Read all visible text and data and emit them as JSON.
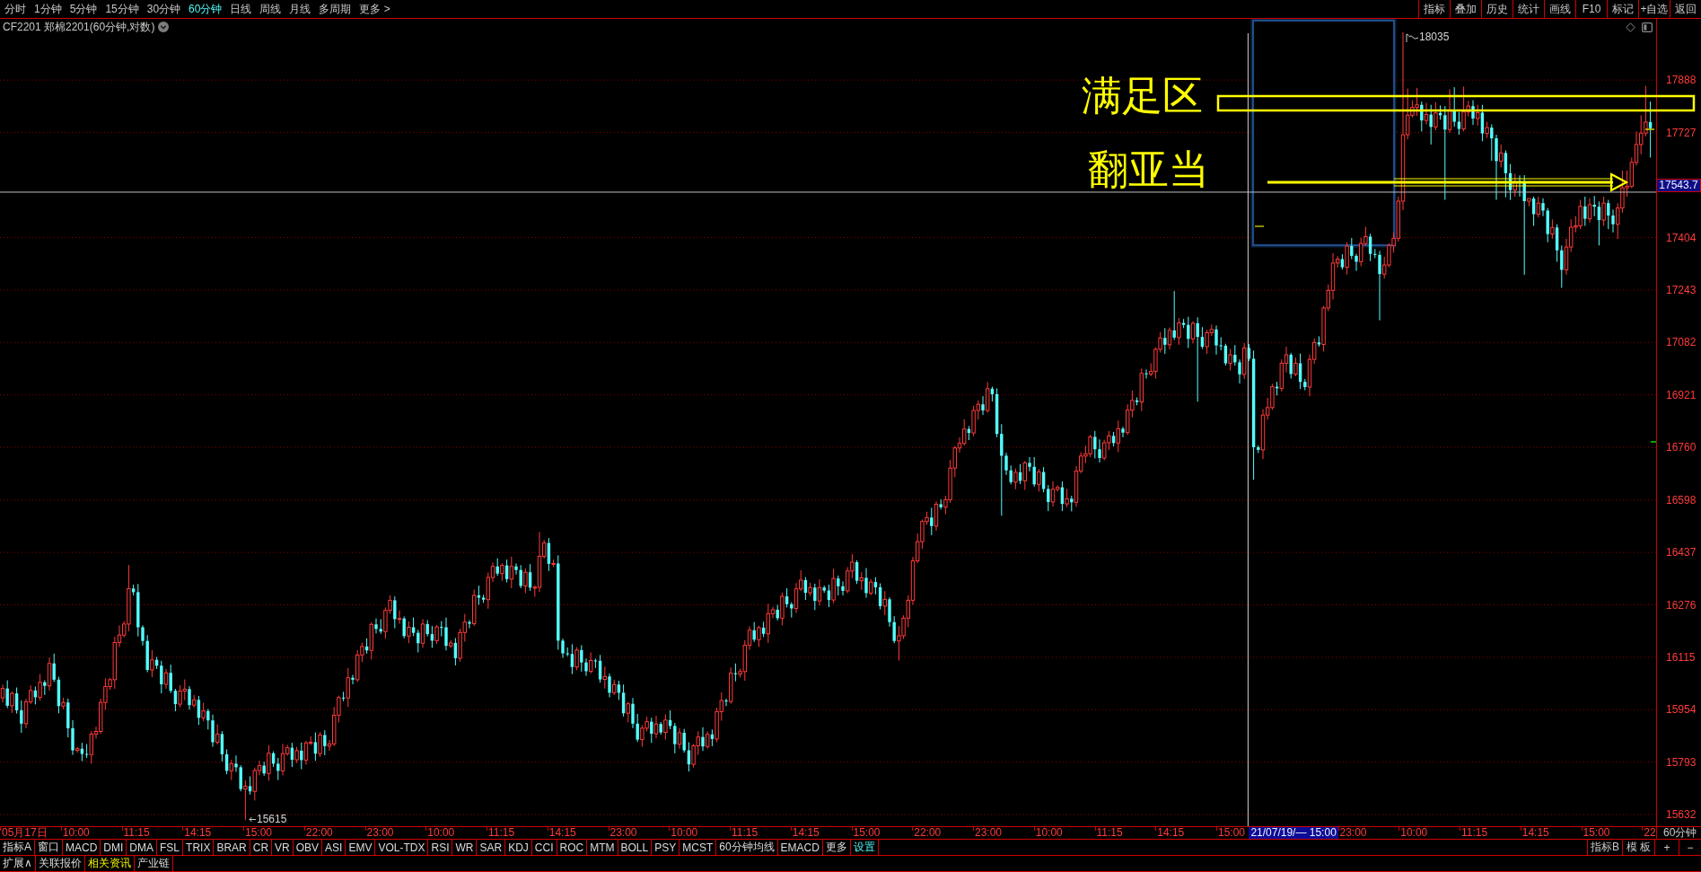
{
  "toolbar": {
    "periods": [
      {
        "label": "分时",
        "selected": false
      },
      {
        "label": "1分钟",
        "selected": false
      },
      {
        "label": "5分钟",
        "selected": false
      },
      {
        "label": "15分钟",
        "selected": false
      },
      {
        "label": "30分钟",
        "selected": false
      },
      {
        "label": "60分钟",
        "selected": true
      },
      {
        "label": "日线",
        "selected": false
      },
      {
        "label": "周线",
        "selected": false
      },
      {
        "label": "月线",
        "selected": false
      },
      {
        "label": "多周期",
        "selected": false
      },
      {
        "label": "更多 >",
        "selected": false
      }
    ],
    "actions": [
      "指标",
      "叠加",
      "历史",
      "统计",
      "画线",
      "F10",
      "标记",
      "+自选",
      "返回"
    ]
  },
  "chart": {
    "title": "CF2201 郑棉2201(60分钟,对数)",
    "high_marker": "18035",
    "low_marker": "15615",
    "annotations": [
      "满足区",
      "翻亚当"
    ],
    "current_price": "17543.7",
    "period_label": "60分钟",
    "time_axis": [
      {
        "kind": "tick",
        "text": "05月17日"
      },
      {
        "kind": "tick",
        "text": "10:00"
      },
      {
        "kind": "tick",
        "text": "11:15"
      },
      {
        "kind": "tick",
        "text": "14:15"
      },
      {
        "kind": "tick",
        "text": "15:00"
      },
      {
        "kind": "tick",
        "text": "22:00"
      },
      {
        "kind": "tick",
        "text": "23:00"
      },
      {
        "kind": "tick",
        "text": "10:00"
      },
      {
        "kind": "tick",
        "text": "11:15"
      },
      {
        "kind": "tick",
        "text": "14:15"
      },
      {
        "kind": "tick",
        "text": "23:00"
      },
      {
        "kind": "tick",
        "text": "10:00"
      },
      {
        "kind": "tick",
        "text": "11:15"
      },
      {
        "kind": "tick",
        "text": "14:15"
      },
      {
        "kind": "tick",
        "text": "15:00"
      },
      {
        "kind": "tick",
        "text": "22:00"
      },
      {
        "kind": "tick",
        "text": "23:00"
      },
      {
        "kind": "tick",
        "text": "10:00"
      },
      {
        "kind": "tick",
        "text": "11:15"
      },
      {
        "kind": "tick",
        "text": "14:15"
      },
      {
        "kind": "tick",
        "text": "15:00"
      },
      {
        "kind": "cursor",
        "text": "21/07/19/— 15:00"
      },
      {
        "kind": "tick",
        "text": "23:00"
      },
      {
        "kind": "tick",
        "text": "10:00"
      },
      {
        "kind": "tick",
        "text": "11:15"
      },
      {
        "kind": "tick",
        "text": "14:15"
      },
      {
        "kind": "tick",
        "text": "15:00"
      },
      {
        "kind": "tick",
        "text": "22"
      }
    ],
    "chart_data": {
      "type": "candlestick",
      "grid": true,
      "ylim": [
        15596,
        18076
      ],
      "yticks": [
        {
          "value": 17888,
          "label": "17888"
        },
        {
          "value": 17727,
          "label": "17727"
        },
        {
          "value": 17404,
          "label": "17404"
        },
        {
          "value": 17243,
          "label": "17243"
        },
        {
          "value": 17082,
          "label": "17082"
        },
        {
          "value": 16921,
          "label": "16921"
        },
        {
          "value": 16760,
          "label": "16760"
        },
        {
          "value": 16598,
          "label": "16598"
        },
        {
          "value": 16437,
          "label": "16437"
        },
        {
          "value": 16276,
          "label": "16276"
        },
        {
          "value": 16115,
          "label": "16115"
        },
        {
          "value": 15954,
          "label": "15954"
        },
        {
          "value": 15793,
          "label": "15793"
        },
        {
          "value": 15632,
          "label": "15632"
        }
      ],
      "ohlc": [
        [
          15990,
          16031,
          15976,
          16019
        ],
        [
          16019,
          16044,
          15959,
          15966
        ],
        [
          15966,
          16010,
          15944,
          16004
        ],
        [
          16004,
          16022,
          15942,
          15952
        ],
        [
          15952,
          15982,
          15883,
          15911
        ],
        [
          15911,
          15987,
          15897,
          15978
        ],
        [
          15978,
          16028,
          15971,
          16013
        ],
        [
          16013,
          16025,
          15970,
          15992
        ],
        [
          15992,
          16063,
          15982,
          16038
        ],
        [
          16038,
          16044,
          15999,
          16027
        ],
        [
          16027,
          16114,
          16013,
          16096
        ],
        [
          16096,
          16126,
          16039,
          16046
        ],
        [
          16046,
          16055,
          15943,
          15965
        ],
        [
          15965,
          15991,
          15955,
          15976
        ],
        [
          15976,
          15988,
          15869,
          15897
        ],
        [
          15897,
          15922,
          15815,
          15829
        ],
        [
          15829,
          15840,
          15822,
          15834
        ],
        [
          15834,
          15852,
          15796,
          15818
        ],
        [
          15818,
          15848,
          15806,
          15816
        ],
        [
          15816,
          15888,
          15788,
          15879
        ],
        [
          15879,
          15902,
          15865,
          15887
        ],
        [
          15887,
          15988,
          15880,
          15976
        ],
        [
          15976,
          16050,
          15954,
          16025
        ],
        [
          16025,
          16052,
          16015,
          16046
        ],
        [
          16046,
          16178,
          16018,
          16160
        ],
        [
          16160,
          16213,
          16146,
          16183
        ],
        [
          16183,
          16226,
          16176,
          16217
        ],
        [
          16217,
          16398,
          16195,
          16326
        ],
        [
          16326,
          16338,
          16305,
          16315
        ],
        [
          16315,
          16340,
          16179,
          16207
        ],
        [
          16207,
          16213,
          16151,
          16165
        ],
        [
          16165,
          16183,
          16069,
          16076
        ],
        [
          16076,
          16137,
          16054,
          16107
        ],
        [
          16107,
          16116,
          16079,
          16089
        ],
        [
          16089,
          16104,
          16004,
          16032
        ],
        [
          16032,
          16079,
          16018,
          16067
        ],
        [
          16067,
          16092,
          16005,
          16012
        ],
        [
          16012,
          16018,
          15949,
          15971
        ],
        [
          15971,
          16029,
          15961,
          16011
        ],
        [
          16011,
          16047,
          15983,
          16017
        ],
        [
          16017,
          16026,
          15954,
          15968
        ],
        [
          15968,
          15999,
          15961,
          15984
        ],
        [
          15984,
          15996,
          15907,
          15929
        ],
        [
          15929,
          15975,
          15919,
          15950
        ],
        [
          15950,
          15956,
          15893,
          15921
        ],
        [
          15921,
          15939,
          15840,
          15854
        ],
        [
          15854,
          15909,
          15847,
          15879
        ],
        [
          15879,
          15888,
          15795,
          15817
        ],
        [
          15817,
          15832,
          15756,
          15766
        ],
        [
          15766,
          15800,
          15738,
          15788
        ],
        [
          15788,
          15813,
          15763,
          15777
        ],
        [
          15777,
          15783,
          15703,
          15710
        ],
        [
          15710,
          15737,
          15615,
          15719
        ],
        [
          15719,
          15749,
          15693,
          15703
        ],
        [
          15703,
          15776,
          15675,
          15767
        ],
        [
          15767,
          15797,
          15753,
          15782
        ],
        [
          15782,
          15794,
          15751,
          15758
        ],
        [
          15758,
          15845,
          15736,
          15820
        ],
        [
          15820,
          15826,
          15778,
          15788
        ],
        [
          15788,
          15806,
          15738,
          15766
        ],
        [
          15766,
          15849,
          15752,
          15819
        ],
        [
          15819,
          15846,
          15812,
          15837
        ],
        [
          15837,
          15852,
          15778,
          15800
        ],
        [
          15800,
          15840,
          15790,
          15828
        ],
        [
          15828,
          15853,
          15771,
          15799
        ],
        [
          15799,
          15858,
          15785,
          15852
        ],
        [
          15852,
          15872,
          15845,
          15854
        ],
        [
          15854,
          15884,
          15797,
          15819
        ],
        [
          15819,
          15885,
          15809,
          15876
        ],
        [
          15876,
          15891,
          15814,
          15842
        ],
        [
          15842,
          15861,
          15828,
          15849
        ],
        [
          15849,
          15962,
          15842,
          15937
        ],
        [
          15937,
          15997,
          15915,
          15991
        ],
        [
          15991,
          16009,
          15980,
          15990
        ],
        [
          15990,
          16082,
          15962,
          16052
        ],
        [
          16052,
          16061,
          16032,
          16046
        ],
        [
          16046,
          16137,
          16039,
          16122
        ],
        [
          16122,
          16160,
          16100,
          16148
        ],
        [
          16148,
          16173,
          16126,
          16136
        ],
        [
          16136,
          16222,
          16108,
          16216
        ],
        [
          16216,
          16234,
          16188,
          16202
        ],
        [
          16202,
          16232,
          16187,
          16194
        ],
        [
          16194,
          16268,
          16172,
          16259
        ],
        [
          16259,
          16305,
          16249,
          16290
        ],
        [
          16290,
          16302,
          16204,
          16232
        ],
        [
          16232,
          16259,
          16218,
          16234
        ],
        [
          16234,
          16240,
          16173,
          16180
        ],
        [
          16180,
          16225,
          16158,
          16207
        ],
        [
          16207,
          16237,
          16180,
          16190
        ],
        [
          16190,
          16199,
          16130,
          16158
        ],
        [
          16158,
          16232,
          16144,
          16217
        ],
        [
          16217,
          16229,
          16179,
          16186
        ],
        [
          16186,
          16211,
          16144,
          16166
        ],
        [
          16166,
          16214,
          16156,
          16208
        ],
        [
          16208,
          16226,
          16179,
          16207
        ],
        [
          16207,
          16237,
          16136,
          16150
        ],
        [
          16150,
          16168,
          16143,
          16159
        ],
        [
          16159,
          16174,
          16090,
          16112
        ],
        [
          16112,
          16203,
          16102,
          16191
        ],
        [
          16191,
          16248,
          16163,
          16223
        ],
        [
          16223,
          16229,
          16204,
          16218
        ],
        [
          16218,
          16323,
          16211,
          16305
        ],
        [
          16305,
          16335,
          16276,
          16298
        ],
        [
          16298,
          16307,
          16282,
          16292
        ],
        [
          16292,
          16375,
          16264,
          16360
        ],
        [
          16360,
          16406,
          16346,
          16394
        ],
        [
          16394,
          16419,
          16365,
          16372
        ],
        [
          16372,
          16403,
          16350,
          16397
        ],
        [
          16397,
          16415,
          16345,
          16355
        ],
        [
          16355,
          16424,
          16327,
          16394
        ],
        [
          16394,
          16403,
          16369,
          16383
        ],
        [
          16383,
          16398,
          16327,
          16334
        ],
        [
          16334,
          16388,
          16312,
          16376
        ],
        [
          16376,
          16401,
          16319,
          16329
        ],
        [
          16329,
          16336,
          16301,
          16330
        ],
        [
          16330,
          16500,
          16316,
          16425
        ],
        [
          16425,
          16475,
          16418,
          16466
        ],
        [
          16466,
          16481,
          16380,
          16402
        ],
        [
          16402,
          16415,
          16392,
          16403
        ],
        [
          16403,
          16428,
          16138,
          16166
        ],
        [
          16166,
          16172,
          16113,
          16127
        ],
        [
          16127,
          16145,
          16118,
          16125
        ],
        [
          16125,
          16155,
          16063,
          16085
        ],
        [
          16085,
          16146,
          16075,
          16137
        ],
        [
          16137,
          16152,
          16071,
          16099
        ],
        [
          16099,
          16111,
          16058,
          16072
        ],
        [
          16072,
          16130,
          16065,
          16105
        ],
        [
          16105,
          16111,
          16082,
          16104
        ],
        [
          16104,
          16122,
          16037,
          16047
        ],
        [
          16047,
          16086,
          16019,
          16056
        ],
        [
          16056,
          16065,
          15992,
          16006
        ],
        [
          16006,
          16046,
          15999,
          16031
        ],
        [
          16031,
          16043,
          15984,
          16006
        ],
        [
          16006,
          16031,
          15933,
          15943
        ],
        [
          15943,
          15978,
          15915,
          15972
        ],
        [
          15972,
          15990,
          15897,
          15911
        ],
        [
          15911,
          15941,
          15855,
          15862
        ],
        [
          15862,
          15906,
          15840,
          15897
        ],
        [
          15897,
          15932,
          15887,
          15917
        ],
        [
          15917,
          15929,
          15852,
          15880
        ],
        [
          15880,
          15935,
          15866,
          15910
        ],
        [
          15910,
          15916,
          15877,
          15884
        ],
        [
          15884,
          15940,
          15862,
          15922
        ],
        [
          15922,
          15952,
          15894,
          15904
        ],
        [
          15904,
          15913,
          15820,
          15848
        ],
        [
          15848,
          15898,
          15834,
          15883
        ],
        [
          15883,
          15895,
          15822,
          15829
        ],
        [
          15829,
          15854,
          15764,
          15786
        ],
        [
          15786,
          15849,
          15776,
          15843
        ],
        [
          15843,
          15888,
          15815,
          15870
        ],
        [
          15870,
          15900,
          15827,
          15841
        ],
        [
          15841,
          15887,
          15834,
          15878
        ],
        [
          15878,
          15893,
          15842,
          15864
        ],
        [
          15864,
          15960,
          15854,
          15948
        ],
        [
          15948,
          16007,
          15920,
          15982
        ],
        [
          15982,
          15988,
          15965,
          15979
        ],
        [
          15979,
          16084,
          15972,
          16066
        ],
        [
          16066,
          16096,
          16041,
          16063
        ],
        [
          16063,
          16080,
          16053,
          16071
        ],
        [
          16071,
          16167,
          16043,
          16152
        ],
        [
          16152,
          16210,
          16138,
          16198
        ],
        [
          16198,
          16223,
          16162,
          16169
        ],
        [
          16169,
          16212,
          16147,
          16206
        ],
        [
          16206,
          16224,
          16177,
          16187
        ],
        [
          16187,
          16279,
          16159,
          16249
        ],
        [
          16249,
          16270,
          16235,
          16261
        ],
        [
          16261,
          16276,
          16228,
          16235
        ],
        [
          16235,
          16314,
          16213,
          16302
        ],
        [
          16302,
          16327,
          16268,
          16278
        ],
        [
          16278,
          16284,
          16237,
          16265
        ],
        [
          16265,
          16343,
          16251,
          16325
        ],
        [
          16325,
          16382,
          16318,
          16352
        ],
        [
          16352,
          16361,
          16291,
          16313
        ],
        [
          16313,
          16344,
          16303,
          16329
        ],
        [
          16329,
          16341,
          16260,
          16288
        ],
        [
          16288,
          16354,
          16274,
          16329
        ],
        [
          16329,
          16335,
          16313,
          16320
        ],
        [
          16320,
          16338,
          16269,
          16291
        ],
        [
          16291,
          16387,
          16281,
          16357
        ],
        [
          16357,
          16366,
          16305,
          16333
        ],
        [
          16333,
          16348,
          16305,
          16319
        ],
        [
          16319,
          16392,
          16312,
          16380
        ],
        [
          16380,
          16432,
          16358,
          16407
        ],
        [
          16407,
          16413,
          16340,
          16350
        ],
        [
          16350,
          16377,
          16322,
          16359
        ],
        [
          16359,
          16389,
          16298,
          16312
        ],
        [
          16312,
          16355,
          16305,
          16346
        ],
        [
          16346,
          16361,
          16308,
          16330
        ],
        [
          16330,
          16342,
          16262,
          16272
        ],
        [
          16272,
          16318,
          16244,
          16293
        ],
        [
          16293,
          16299,
          16209,
          16223
        ],
        [
          16223,
          16241,
          16158,
          16165
        ],
        [
          16165,
          16211,
          16105,
          16181
        ],
        [
          16181,
          16244,
          16171,
          16235
        ],
        [
          16235,
          16305,
          16207,
          16290
        ],
        [
          16290,
          16423,
          16276,
          16411
        ],
        [
          16411,
          16495,
          16404,
          16470
        ],
        [
          16470,
          16538,
          16448,
          16532
        ],
        [
          16532,
          16562,
          16522,
          16544
        ],
        [
          16544,
          16574,
          16490,
          16518
        ],
        [
          16518,
          16594,
          16504,
          16585
        ],
        [
          16585,
          16600,
          16569,
          16576
        ],
        [
          16576,
          16611,
          16554,
          16599
        ],
        [
          16599,
          16721,
          16589,
          16696
        ],
        [
          16696,
          16764,
          16668,
          16758
        ],
        [
          16758,
          16790,
          16744,
          16772
        ],
        [
          16772,
          16846,
          16765,
          16816
        ],
        [
          16816,
          16825,
          16782,
          16804
        ],
        [
          16804,
          16888,
          16794,
          16873
        ],
        [
          16873,
          16904,
          16845,
          16892
        ],
        [
          16892,
          16917,
          16859,
          16873
        ],
        [
          16873,
          16960,
          16866,
          16940
        ],
        [
          16940,
          16946,
          16901,
          16923
        ],
        [
          16923,
          16941,
          16791,
          16801
        ],
        [
          16801,
          16831,
          16550,
          16734
        ],
        [
          16734,
          16743,
          16675,
          16689
        ],
        [
          16689,
          16704,
          16646,
          16653
        ],
        [
          16653,
          16695,
          16631,
          16683
        ],
        [
          16683,
          16708,
          16647,
          16657
        ],
        [
          16657,
          16718,
          16629,
          16712
        ],
        [
          16712,
          16730,
          16686,
          16700
        ],
        [
          16700,
          16730,
          16639,
          16646
        ],
        [
          16646,
          16693,
          16624,
          16684
        ],
        [
          16684,
          16699,
          16622,
          16632
        ],
        [
          16632,
          16644,
          16564,
          16592
        ],
        [
          16592,
          16656,
          16578,
          16631
        ],
        [
          16631,
          16643,
          16624,
          16637
        ],
        [
          16637,
          16655,
          16564,
          16586
        ],
        [
          16586,
          16632,
          16576,
          16602
        ],
        [
          16602,
          16611,
          16563,
          16591
        ],
        [
          16591,
          16702,
          16577,
          16687
        ],
        [
          16687,
          16745,
          16680,
          16733
        ],
        [
          16733,
          16765,
          16711,
          16740
        ],
        [
          16740,
          16798,
          16730,
          16792
        ],
        [
          16792,
          16810,
          16726,
          16754
        ],
        [
          16754,
          16784,
          16713,
          16727
        ],
        [
          16727,
          16783,
          16720,
          16774
        ],
        [
          16774,
          16810,
          16752,
          16795
        ],
        [
          16795,
          16807,
          16763,
          16773
        ],
        [
          16773,
          16842,
          16745,
          16817
        ],
        [
          16817,
          16823,
          16791,
          16805
        ],
        [
          16805,
          16892,
          16798,
          16874
        ],
        [
          16874,
          16934,
          16852,
          16904
        ],
        [
          16904,
          16913,
          16889,
          16899
        ],
        [
          16899,
          17002,
          16871,
          16987
        ],
        [
          16987,
          16999,
          16971,
          16985
        ],
        [
          16985,
          17018,
          16978,
          16993
        ],
        [
          16993,
          17067,
          16971,
          17061
        ],
        [
          17061,
          17114,
          17051,
          17096
        ],
        [
          17096,
          17126,
          17047,
          17075
        ],
        [
          17075,
          17128,
          17061,
          17119
        ],
        [
          17119,
          17240,
          17090,
          17097
        ],
        [
          17097,
          17157,
          17075,
          17142
        ],
        [
          17142,
          17154,
          17126,
          17136
        ],
        [
          17136,
          17161,
          17065,
          17093
        ],
        [
          17093,
          17147,
          17079,
          17141
        ],
        [
          17141,
          17159,
          16900,
          17099
        ],
        [
          17099,
          17129,
          17062,
          17069
        ],
        [
          17069,
          17121,
          17047,
          17112
        ],
        [
          17112,
          17137,
          17102,
          17122
        ],
        [
          17122,
          17134,
          17045,
          17073
        ],
        [
          17073,
          17098,
          17058,
          17072
        ],
        [
          17072,
          17078,
          17011,
          17018
        ],
        [
          17018,
          17062,
          16996,
          17044
        ],
        [
          17044,
          17074,
          17011,
          17021
        ],
        [
          17021,
          17030,
          16956,
          16984
        ],
        [
          16984,
          17080,
          16970,
          17065
        ],
        [
          17065,
          17077,
          17025,
          17032
        ],
        [
          17032,
          17057,
          16660,
          16760
        ],
        [
          16760,
          16766,
          16742,
          16752
        ],
        [
          16752,
          16877,
          16724,
          16859
        ],
        [
          16859,
          16912,
          16845,
          16882
        ],
        [
          16882,
          16955,
          16875,
          16946
        ],
        [
          16946,
          16961,
          16919,
          16941
        ],
        [
          16941,
          17030,
          16931,
          17018
        ],
        [
          17018,
          17069,
          16990,
          17044
        ],
        [
          17044,
          17050,
          16971,
          16985
        ],
        [
          16985,
          17036,
          16978,
          17018
        ],
        [
          17018,
          17048,
          16939,
          16961
        ],
        [
          16961,
          16970,
          16935,
          16945
        ],
        [
          16945,
          17045,
          16917,
          17030
        ],
        [
          17030,
          17094,
          17016,
          17082
        ],
        [
          17082,
          17101,
          17069,
          17076
        ],
        [
          17076,
          17194,
          17054,
          17188
        ],
        [
          17188,
          17260,
          17178,
          17242
        ],
        [
          17242,
          17356,
          17214,
          17326
        ],
        [
          17326,
          17347,
          17312,
          17338
        ],
        [
          17338,
          17353,
          17306,
          17313
        ],
        [
          17313,
          17390,
          17291,
          17378
        ],
        [
          17378,
          17403,
          17338,
          17348
        ],
        [
          17348,
          17354,
          17302,
          17330
        ],
        [
          17330,
          17404,
          17316,
          17386
        ],
        [
          17386,
          17437,
          17379,
          17407
        ],
        [
          17407,
          17416,
          17332,
          17354
        ],
        [
          17354,
          17369,
          17341,
          17351
        ],
        [
          17351,
          17363,
          17150,
          17292
        ],
        [
          17292,
          17345,
          17278,
          17320
        ],
        [
          17320,
          17386,
          17313,
          17380
        ],
        [
          17380,
          17420,
          17358,
          17402
        ],
        [
          17402,
          17530,
          17392,
          17516
        ],
        [
          17516,
          18035,
          17488,
          17720
        ],
        [
          17720,
          17862,
          17706,
          17780
        ],
        [
          17780,
          17826,
          17773,
          17804
        ],
        [
          17804,
          17864,
          17778,
          17812
        ],
        [
          17812,
          17822,
          17730,
          17764
        ],
        [
          17764,
          17818,
          17752,
          17782
        ],
        [
          17782,
          17812,
          17690,
          17744
        ],
        [
          17744,
          17820,
          17734,
          17787
        ],
        [
          17787,
          17810,
          17766,
          17780
        ],
        [
          17780,
          17808,
          17520,
          17736
        ],
        [
          17736,
          17860,
          17726,
          17793
        ],
        [
          17793,
          17866,
          17745,
          17760
        ],
        [
          17760,
          17790,
          17720,
          17738
        ],
        [
          17738,
          17868,
          17730,
          17790
        ],
        [
          17790,
          17824,
          17776,
          17808
        ],
        [
          17808,
          17826,
          17750,
          17770
        ],
        [
          17770,
          17812,
          17748,
          17788
        ],
        [
          17788,
          17812,
          17700,
          17724
        ],
        [
          17724,
          17760,
          17710,
          17742
        ],
        [
          17742,
          17752,
          17640,
          17709
        ],
        [
          17709,
          17720,
          17520,
          17639
        ],
        [
          17639,
          17690,
          17620,
          17664
        ],
        [
          17664,
          17672,
          17528,
          17602
        ],
        [
          17602,
          17630,
          17520,
          17550
        ],
        [
          17550,
          17600,
          17530,
          17575
        ],
        [
          17575,
          17595,
          17530,
          17573
        ],
        [
          17573,
          17596,
          17290,
          17516
        ],
        [
          17516,
          17524,
          17500,
          17524
        ],
        [
          17524,
          17530,
          17440,
          17476
        ],
        [
          17476,
          17530,
          17466,
          17510
        ],
        [
          17510,
          17525,
          17470,
          17487
        ],
        [
          17487,
          17495,
          17390,
          17415
        ],
        [
          17415,
          17460,
          17400,
          17435
        ],
        [
          17435,
          17445,
          17330,
          17365
        ],
        [
          17365,
          17380,
          17250,
          17305
        ],
        [
          17305,
          17400,
          17290,
          17375
        ],
        [
          17375,
          17460,
          17360,
          17436
        ],
        [
          17436,
          17470,
          17420,
          17440
        ],
        [
          17440,
          17520,
          17430,
          17500
        ],
        [
          17500,
          17530,
          17440,
          17462
        ],
        [
          17462,
          17525,
          17450,
          17505
        ],
        [
          17505,
          17532,
          17470,
          17499
        ],
        [
          17499,
          17515,
          17380,
          17458
        ],
        [
          17458,
          17530,
          17440,
          17510
        ],
        [
          17510,
          17520,
          17430,
          17472
        ],
        [
          17472,
          17490,
          17420,
          17445
        ],
        [
          17445,
          17510,
          17400,
          17495
        ],
        [
          17495,
          17610,
          17480,
          17557
        ],
        [
          17557,
          17610,
          17530,
          17562
        ],
        [
          17562,
          17650,
          17556,
          17635
        ],
        [
          17635,
          17730,
          17625,
          17690
        ],
        [
          17690,
          17780,
          17660,
          17725
        ],
        [
          17725,
          17870,
          17715,
          17759
        ],
        [
          17759,
          17822,
          17650,
          17740
        ]
      ]
    }
  },
  "indicator_bar": {
    "items": [
      {
        "label": "指标A",
        "kind": "item"
      },
      {
        "label": "窗口",
        "kind": "item"
      },
      {
        "label": "MACD",
        "kind": "item"
      },
      {
        "label": "DMI",
        "kind": "item"
      },
      {
        "label": "DMA",
        "kind": "item"
      },
      {
        "label": "FSL",
        "kind": "item"
      },
      {
        "label": "TRIX",
        "kind": "item"
      },
      {
        "label": "BRAR",
        "kind": "item"
      },
      {
        "label": "CR",
        "kind": "item"
      },
      {
        "label": "VR",
        "kind": "item"
      },
      {
        "label": "OBV",
        "kind": "item"
      },
      {
        "label": "ASI",
        "kind": "item"
      },
      {
        "label": "EMV",
        "kind": "item"
      },
      {
        "label": "VOL-TDX",
        "kind": "item"
      },
      {
        "label": "RSI",
        "kind": "item"
      },
      {
        "label": "WR",
        "kind": "item"
      },
      {
        "label": "SAR",
        "kind": "item"
      },
      {
        "label": "KDJ",
        "kind": "item"
      },
      {
        "label": "CCI",
        "kind": "item"
      },
      {
        "label": "ROC",
        "kind": "item"
      },
      {
        "label": "MTM",
        "kind": "item"
      },
      {
        "label": "BOLL",
        "kind": "item"
      },
      {
        "label": "PSY",
        "kind": "item"
      },
      {
        "label": "MCST",
        "kind": "item"
      },
      {
        "label": "60分钟均线",
        "kind": "item"
      },
      {
        "label": "EMACD",
        "kind": "item"
      },
      {
        "label": "更多",
        "kind": "item"
      },
      {
        "label": "设置",
        "kind": "setting"
      }
    ],
    "right_items": [
      "指标B",
      "模 板",
      "+",
      "−"
    ]
  },
  "extension_bar": {
    "tabs": [
      {
        "label": "扩展∧",
        "selected": false
      },
      {
        "label": "关联报价",
        "selected": false
      },
      {
        "label": "相关资讯",
        "selected": true
      },
      {
        "label": "产业链",
        "selected": false
      }
    ]
  }
}
